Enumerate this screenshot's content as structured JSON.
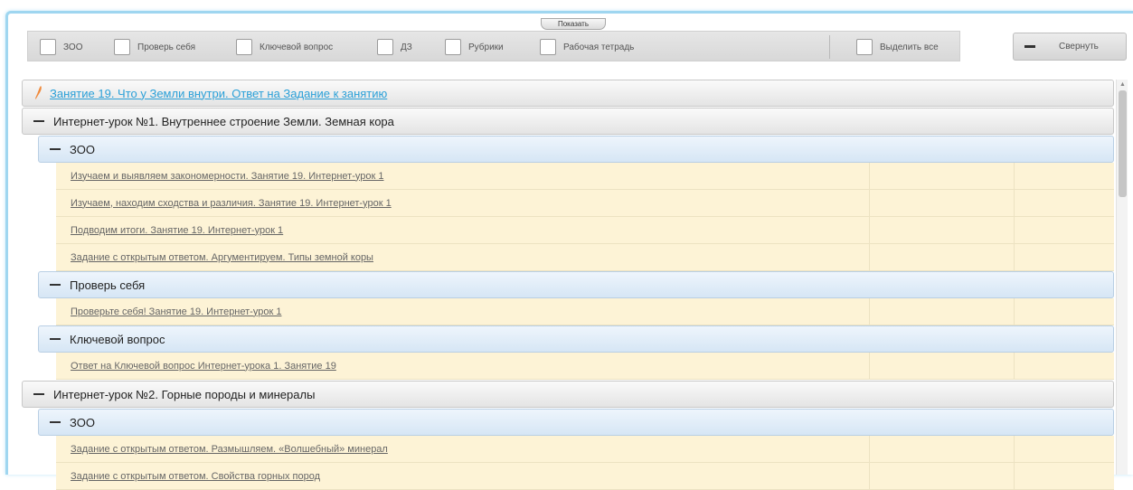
{
  "toolbar": {
    "show_label": "Показать",
    "filters": [
      {
        "label": "ЗОО"
      },
      {
        "label": "Проверь себя"
      },
      {
        "label": "Ключевой вопрос"
      },
      {
        "label": "ДЗ"
      },
      {
        "label": "Рубрики"
      },
      {
        "label": "Рабочая тетрадь"
      }
    ],
    "select_all_label": "Выделить все",
    "collapse_label": "Свернуть"
  },
  "lesson": {
    "link": "Занятие 19. Что у Земли внутри. Ответ на Задание к занятию",
    "lessons": [
      {
        "title": "Интернет-урок №1. Внутреннее строение Земли. Земная кора",
        "sections": [
          {
            "title": "ЗОО",
            "tasks": [
              "Изучаем и выявляем закономерности. Занятие 19. Интернет-урок 1",
              "Изучаем, находим сходства и различия. Занятие 19. Интернет-урок 1",
              "Подводим итоги. Занятие 19. Интернет-урок 1",
              "Задание с открытым ответом. Аргументируем. Типы земной коры"
            ]
          },
          {
            "title": "Проверь себя",
            "tasks": [
              "Проверьте себя! Занятие 19. Интернет-урок 1"
            ]
          },
          {
            "title": "Ключевой вопрос",
            "tasks": [
              "Ответ на Ключевой вопрос Интернет-урока 1. Занятие 19"
            ]
          }
        ]
      },
      {
        "title": "Интернет-урок №2. Горные породы и минералы",
        "sections": [
          {
            "title": "ЗОО",
            "tasks": [
              "Задание с открытым ответом. Размышляем. «Волшебный» минерал",
              "Задание с открытым ответом. Свойства горных пород"
            ]
          }
        ]
      }
    ]
  },
  "colors": {
    "accent_link": "#2aa0d8",
    "task_row_bg": "#fdf3d6",
    "section_bg": "#d6e6f5",
    "frame_border": "#9fd6f0",
    "pen_icon": "#f08a3c"
  },
  "icons": {
    "lesson_marker": "pen-icon",
    "expand_toggle": "minus-icon"
  }
}
